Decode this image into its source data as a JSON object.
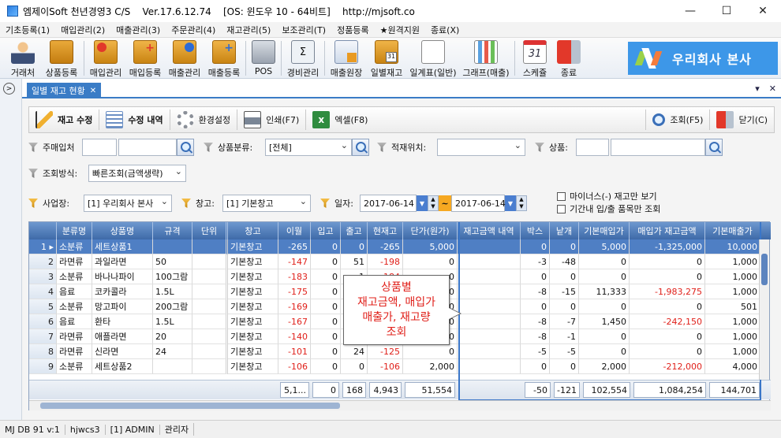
{
  "window": {
    "title": "엠제이Soft 천년경영3 C/S    Ver.17.6.12.74    [OS: 윈도우 10 - 64비트]    http://mjsoft.co",
    "minimize": "—",
    "maximize": "☐",
    "close": "✕"
  },
  "menu": [
    "기초등록(1)",
    "매입관리(2)",
    "매출관리(3)",
    "주문관리(4)",
    "재고관리(5)",
    "보조관리(T)",
    "정품등록",
    "★원격지원",
    "종료(X)"
  ],
  "toolbar": [
    {
      "label": "거래처",
      "icon": "person-icon"
    },
    {
      "label": "상품등록",
      "icon": "boxes-icon"
    },
    {
      "label": "매입관리",
      "icon": "box-in-icon"
    },
    {
      "label": "매입등록",
      "icon": "box-plus-icon"
    },
    {
      "label": "매출관리",
      "icon": "box-out-icon"
    },
    {
      "label": "매출등록",
      "icon": "box-plus-blue-icon"
    },
    {
      "label": "POS",
      "icon": "register-icon"
    },
    {
      "label": "경비관리",
      "icon": "calculator-icon"
    },
    {
      "label": "매출원장",
      "icon": "ledger-icon"
    },
    {
      "label": "일별재고",
      "icon": "calendar-box-icon"
    },
    {
      "label": "일계표(일반)",
      "icon": "report-icon"
    },
    {
      "label": "그래프(매출)",
      "icon": "chart-icon"
    },
    {
      "label": "스케쥴",
      "icon": "calendar-icon"
    },
    {
      "label": "종료",
      "icon": "exit-icon"
    }
  ],
  "banner": {
    "text": "우리회사 본사"
  },
  "doc_tab": {
    "label": "일별 재고 현황",
    "close": "✕"
  },
  "doc_controls": {
    "menu": "▾",
    "close": "✕"
  },
  "actions": {
    "stock_edit": "재고 수정",
    "edit_history": "수정 내역",
    "settings": "환경설정",
    "print": "인쇄(F7)",
    "excel": "엑셀(F8)",
    "search": "조회(F5)",
    "close": "닫기(C)"
  },
  "filters": {
    "main_supplier_label": "주매입처",
    "main_supplier_value": "",
    "category_label": "상품분류:",
    "category_value": "[전체]",
    "location_label": "적재위치:",
    "location_value": "",
    "product_label": "상품:",
    "product_value": "",
    "query_mode_label": "조회방식:",
    "query_mode_value": "빠른조회(금액생략)",
    "site_label": "사업장:",
    "site_value": "[1] 우리회사 본사",
    "warehouse_label": "창고:",
    "warehouse_value": "[1] 기본창고",
    "date_label": "일자:",
    "date_from": "2017-06-14",
    "date_to": "2017-06-14",
    "tilde": "~",
    "chk_minus": "마이너스(-) 재고만 보기",
    "chk_period": "기간내 입/출 품목만 조회"
  },
  "grid": {
    "columns": [
      "",
      "분류명",
      "상품명",
      "규격",
      "단위",
      "창고",
      "이월",
      "입고",
      "출고",
      "현재고",
      "단가(원가)",
      "재고금액 내역",
      "박스",
      "낱개",
      "기본매입가",
      "매입가 재고금액",
      "기본매출가"
    ],
    "rows": [
      [
        "1",
        "소분류",
        "세트상품1",
        "",
        "",
        "기본창고",
        "-265",
        "0",
        "0",
        "-265",
        "5,000",
        "",
        "0",
        "0",
        "5,000",
        "-1,325,000",
        "10,000"
      ],
      [
        "2",
        "라면류",
        "과일라면",
        "50",
        "",
        "기본창고",
        "-147",
        "0",
        "51",
        "-198",
        "0",
        "",
        "-3",
        "-48",
        "0",
        "0",
        "1,000"
      ],
      [
        "3",
        "소분류",
        "바나나파이",
        "100그람",
        "",
        "기본창고",
        "-183",
        "0",
        "1",
        "-184",
        "0",
        "",
        "0",
        "0",
        "0",
        "0",
        "1,000"
      ],
      [
        "4",
        "음료",
        "코카콜라",
        "1.5L",
        "",
        "기본창고",
        "-175",
        "0",
        "0",
        "-175",
        "0",
        "",
        "-8",
        "-15",
        "11,333",
        "-1,983,275",
        "1,000"
      ],
      [
        "5",
        "소분류",
        "망고파이",
        "200그람",
        "",
        "기본창고",
        "-169",
        "0",
        "0",
        "-169",
        "0",
        "",
        "0",
        "0",
        "0",
        "0",
        "501"
      ],
      [
        "6",
        "음료",
        "환타",
        "1.5L",
        "",
        "기본창고",
        "-167",
        "0",
        "0",
        "-167",
        "0",
        "",
        "-8",
        "-7",
        "1,450",
        "-242,150",
        "1,000"
      ],
      [
        "7",
        "라면류",
        "애플라면",
        "20",
        "",
        "기본창고",
        "-140",
        "0",
        "0",
        "-140",
        "0",
        "",
        "-8",
        "-1",
        "0",
        "0",
        "1,000"
      ],
      [
        "8",
        "라면류",
        "신라면",
        "24",
        "",
        "기본창고",
        "-101",
        "0",
        "24",
        "-125",
        "0",
        "",
        "-5",
        "-5",
        "0",
        "0",
        "1,000"
      ],
      [
        "9",
        "소분류",
        "세트상품2",
        "",
        "",
        "기본창고",
        "-106",
        "0",
        "0",
        "-106",
        "2,000",
        "",
        "0",
        "0",
        "2,000",
        "-212,000",
        "4,000"
      ]
    ],
    "totals": {
      "carry": "5,1...",
      "in": "0",
      "out": "168",
      "stock": "4,943",
      "cost": "51,554",
      "box": "-50",
      "unit": "-121",
      "base_buy": "102,554",
      "buy_stock_amt": "1,084,254",
      "base_sell": "144,701"
    }
  },
  "callout": {
    "lines": [
      "상품별",
      "재고금액, 매입가",
      "매출가, 재고량",
      "조회"
    ]
  },
  "status": [
    "MJ DB 91 v:1",
    "hjwcs3",
    "[1] ADMIN",
    "관리자"
  ],
  "colors": {
    "accent": "#3a7cc6",
    "negative": "#e0201a",
    "banner": "#3d97e8",
    "header": "#4a76b6"
  }
}
